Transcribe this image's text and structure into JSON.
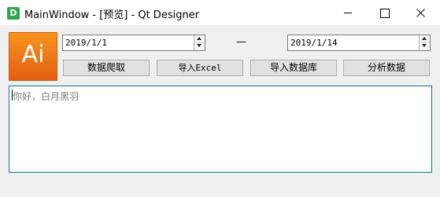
{
  "window": {
    "title": "MainWindow - [预览] - Qt Designer",
    "app_icon_letter": "D"
  },
  "logo": {
    "text": "Ai"
  },
  "dates": {
    "start": "2019/1/1",
    "separator": "—",
    "end": "2019/1/14"
  },
  "buttons": {
    "crawl": "数据爬取",
    "export_excel": "导入Excel",
    "import_db": "导入数据库",
    "analyze": "分析数据"
  },
  "editor": {
    "placeholder": "你好，白月黑羽"
  }
}
